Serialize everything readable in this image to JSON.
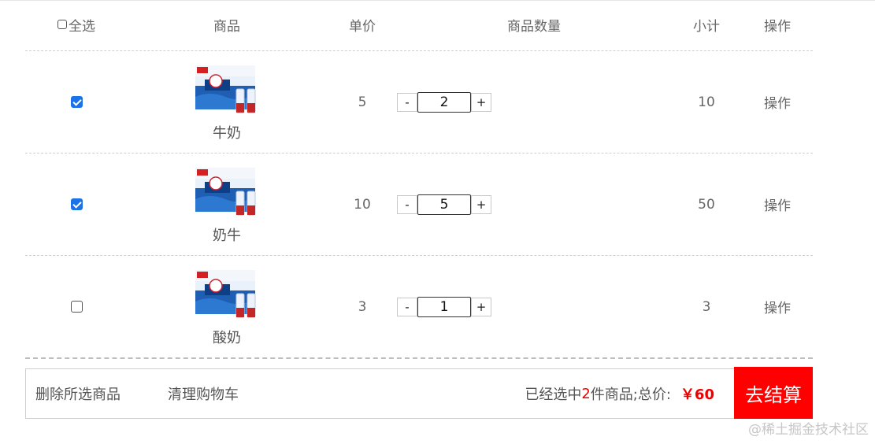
{
  "table": {
    "headers": {
      "select_all": "全选",
      "goods": "商品",
      "price": "单价",
      "quantity": "商品数量",
      "subtotal": "小计",
      "action": "操作"
    },
    "items": [
      {
        "checked": true,
        "name": "牛奶",
        "price": "5",
        "quantity": "2",
        "subtotal": "10",
        "action": "操作",
        "image": "milk-box-image"
      },
      {
        "checked": true,
        "name": "奶牛",
        "price": "10",
        "quantity": "5",
        "subtotal": "50",
        "action": "操作",
        "image": "milk-box-image"
      },
      {
        "checked": false,
        "name": "酸奶",
        "price": "3",
        "quantity": "1",
        "subtotal": "3",
        "action": "操作",
        "image": "milk-box-image"
      }
    ],
    "minus_label": "-",
    "plus_label": "+"
  },
  "footer": {
    "delete_selected": "删除所选商品",
    "clear_cart": "清理购物车",
    "selected_prefix": "已经选中",
    "selected_count": "2",
    "selected_suffix": "件商品;总价:",
    "total": "￥60",
    "checkout": "去结算"
  },
  "watermark": "@稀土掘金技术社区",
  "colors": {
    "accent_red": "#ff0000",
    "checkbox_blue": "#1a73e8",
    "text_gray": "#666666"
  }
}
